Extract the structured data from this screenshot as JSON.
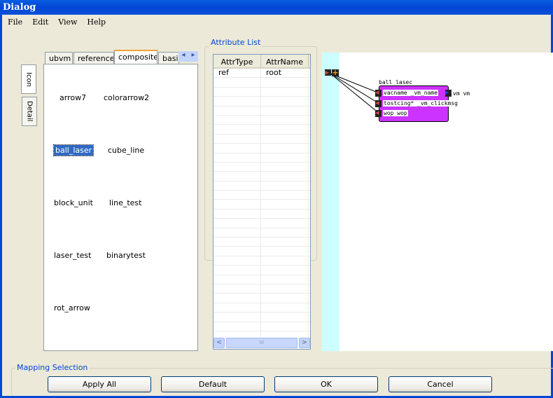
{
  "window": {
    "title": "Dialog"
  },
  "menu": [
    "File",
    "Edit",
    "View",
    "Help"
  ],
  "side_tabs": [
    "Icon",
    "Detail"
  ],
  "tabs": [
    {
      "label": "ubvm"
    },
    {
      "label": "reference"
    },
    {
      "label": "composite",
      "selected": true
    },
    {
      "label": "basic"
    }
  ],
  "tab_scroll": {
    "left": "◂",
    "right": "▸"
  },
  "items": [
    "arrow7",
    "colorarrow2",
    "ball_laser",
    "cube_line",
    "block_unit",
    "line_test",
    "laser_test",
    "binarytest",
    "rot_arrow"
  ],
  "selected_item": "ball_laser",
  "attribute_list": {
    "title": "Attribute List",
    "columns": [
      "AttrType",
      "AttrName"
    ],
    "rows": [
      [
        "ref",
        "root"
      ]
    ],
    "scroll_thumb": "III"
  },
  "node": {
    "title": "ball lasec",
    "ports": [
      "vacname _vm_name",
      "tostcing* _vm_clickmsg",
      "wop wop"
    ],
    "output": "vm vm",
    "color": "#cc33ff"
  },
  "mapping": {
    "title": "Mapping Selection",
    "buttons": [
      "Apply All",
      "Default",
      "OK",
      "Cancel"
    ]
  }
}
